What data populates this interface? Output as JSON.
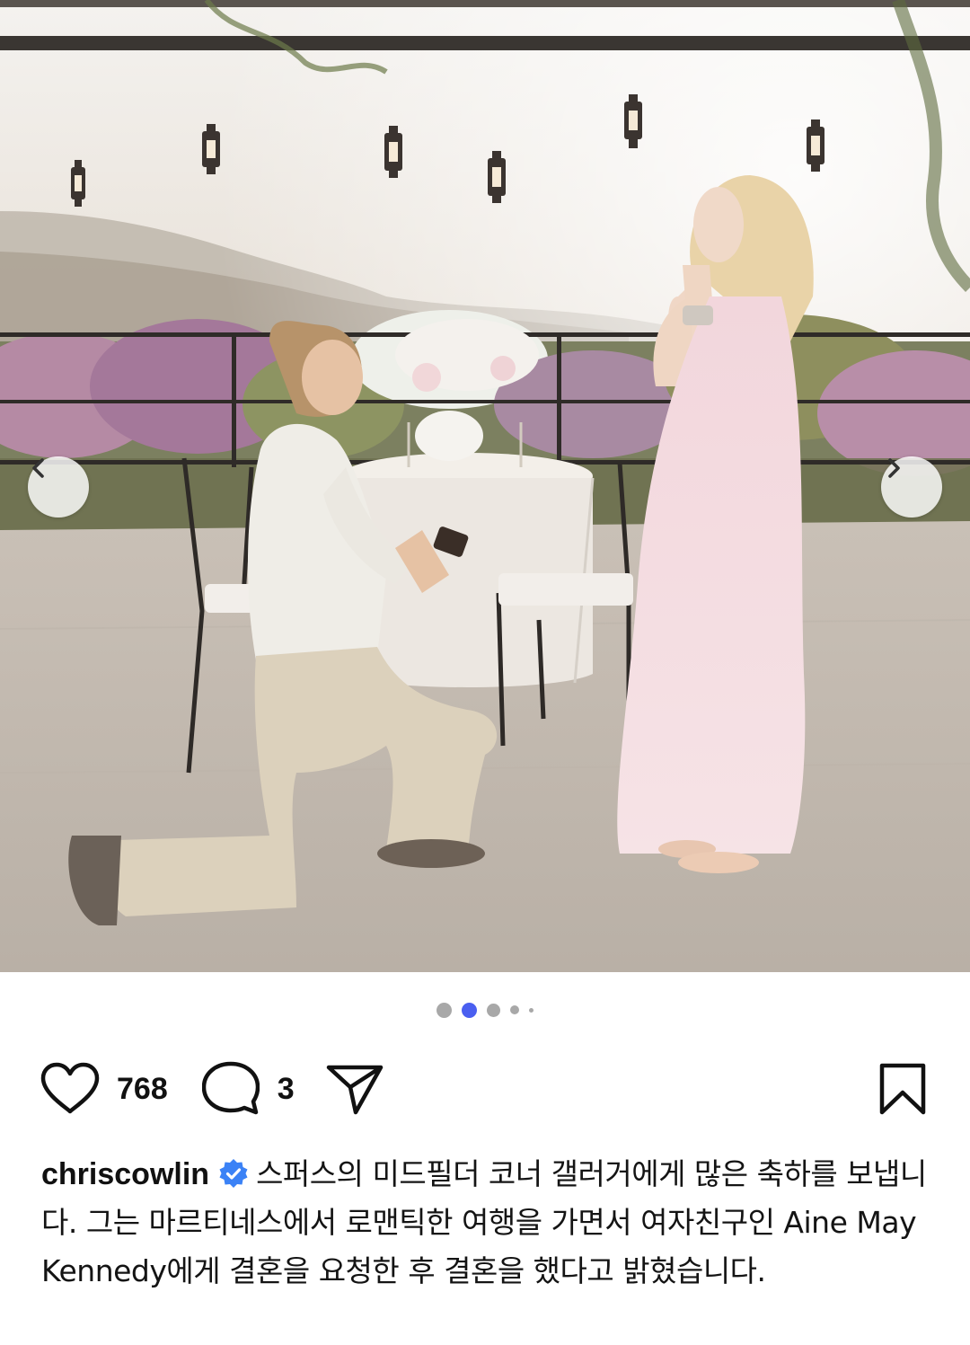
{
  "post": {
    "image_alt": "",
    "carousel": {
      "total": 5,
      "active_index": 1
    }
  },
  "actions": {
    "like_count": "768",
    "comment_count": "3"
  },
  "caption": {
    "username": "chriscowlin",
    "verified": true,
    "text": "스퍼스의 미드필더 코너 갤러거에게 많은 축하를 보냅니다. 그는 마르티네스에서 로맨틱한 여행을 가면서 여자친구인 Aine May Kennedy에게 결혼을 요청한 후 결혼을 했다고 밝혔습니다."
  },
  "icons": {
    "prev": "chevron-left-icon",
    "next": "chevron-right-icon",
    "like": "heart-icon",
    "comment": "comment-bubble-icon",
    "share": "paper-plane-icon",
    "save": "bookmark-icon",
    "verified": "verified-badge-icon"
  },
  "colors": {
    "accent_dot": "#4a5ff0",
    "verified_badge": "#3b82f6",
    "text": "#111111"
  }
}
